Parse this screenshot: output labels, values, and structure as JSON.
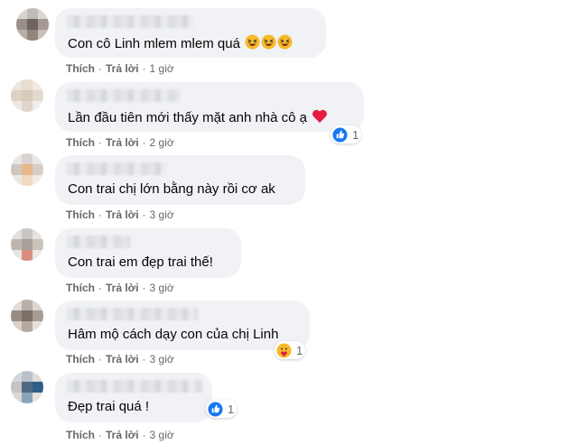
{
  "actions": {
    "like": "Thích",
    "reply": "Trả lời",
    "separator": "·"
  },
  "colors": {
    "bubble": "#f0f2f5",
    "action_text": "#65676b",
    "like_blue": "#1877f2",
    "heart": "#e41e3f"
  },
  "comments": [
    {
      "text": "Con cô Linh mlem mlem quá",
      "emoji": "laughing-emoji x3",
      "time": "1 giờ"
    },
    {
      "text": "Lần đầu tiên mới thấy mặt anh nhà cô ạ",
      "emoji": "red-heart-emoji",
      "reaction": {
        "icon": "like-icon",
        "count": "1"
      },
      "time": "2 giờ"
    },
    {
      "text": "Con trai chị lớn bằng này rồi cơ ak",
      "time": "3 giờ"
    },
    {
      "text": "Con trai em đẹp trai thế!",
      "time": "3 giờ"
    },
    {
      "text": "Hâm mộ cách dạy con của chị Linh",
      "reaction": {
        "icon": "care-icon",
        "count": "1"
      },
      "time": "3 giờ"
    },
    {
      "text": "Đẹp trai quá !",
      "reaction": {
        "icon": "like-icon",
        "count": "1"
      },
      "time": "3 giờ"
    }
  ]
}
